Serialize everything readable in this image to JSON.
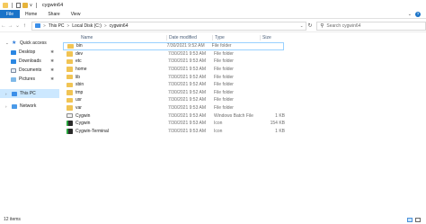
{
  "window": {
    "title": "cygwin64",
    "qa_more": "∨"
  },
  "ribbon": {
    "tabs": [
      "File",
      "Home",
      "Share",
      "View"
    ]
  },
  "address": {
    "breadcrumbs": [
      "This PC",
      "Local Disk (C:)",
      "cygwin64"
    ],
    "search_placeholder": "Search cygwin64"
  },
  "sidebar": {
    "items": [
      {
        "label": "Quick access",
        "icon": "star-icon",
        "indent": false,
        "pinned": false
      },
      {
        "label": "Desktop",
        "icon": "desktop-icon",
        "indent": true,
        "pinned": true
      },
      {
        "label": "Downloads",
        "icon": "downloads-icon",
        "indent": true,
        "pinned": true
      },
      {
        "label": "Documents",
        "icon": "documents-icon",
        "indent": true,
        "pinned": true
      },
      {
        "label": "Pictures",
        "icon": "pictures-icon",
        "indent": true,
        "pinned": true
      },
      {
        "label": "This PC",
        "icon": "this-pc-icon",
        "indent": false,
        "pinned": false,
        "selected": true
      },
      {
        "label": "Network",
        "icon": "network-icon",
        "indent": false,
        "pinned": false
      }
    ]
  },
  "columns": {
    "name": "Name",
    "date": "Date modified",
    "type": "Type",
    "size": "Size"
  },
  "files": [
    {
      "name": "bin",
      "date": "7/30/2021 9:52 AM",
      "type": "File folder",
      "size": "",
      "icon": "folder-icon"
    },
    {
      "name": "dev",
      "date": "7/30/2021 9:53 AM",
      "type": "File folder",
      "size": "",
      "icon": "folder-icon"
    },
    {
      "name": "etc",
      "date": "7/30/2021 9:53 AM",
      "type": "File folder",
      "size": "",
      "icon": "folder-icon"
    },
    {
      "name": "home",
      "date": "7/30/2021 9:53 AM",
      "type": "File folder",
      "size": "",
      "icon": "folder-icon"
    },
    {
      "name": "lib",
      "date": "7/30/2021 9:52 AM",
      "type": "File folder",
      "size": "",
      "icon": "folder-icon"
    },
    {
      "name": "sbin",
      "date": "7/30/2021 9:52 AM",
      "type": "File folder",
      "size": "",
      "icon": "folder-icon"
    },
    {
      "name": "tmp",
      "date": "7/30/2021 9:52 AM",
      "type": "File folder",
      "size": "",
      "icon": "folder-icon"
    },
    {
      "name": "usr",
      "date": "7/30/2021 9:52 AM",
      "type": "File folder",
      "size": "",
      "icon": "folder-icon"
    },
    {
      "name": "var",
      "date": "7/30/2021 9:53 AM",
      "type": "File folder",
      "size": "",
      "icon": "folder-icon"
    },
    {
      "name": "Cygwin",
      "date": "7/30/2021 9:53 AM",
      "type": "Windows Batch File",
      "size": "1 KB",
      "icon": "batch-file-icon"
    },
    {
      "name": "Cygwin",
      "date": "7/30/2021 9:53 AM",
      "type": "Icon",
      "size": "154 KB",
      "icon": "cygwin-icon"
    },
    {
      "name": "Cygwin-Terminal",
      "date": "7/30/2021 9:53 AM",
      "type": "Icon",
      "size": "1 KB",
      "icon": "cygwin-terminal-icon"
    }
  ],
  "status": {
    "count_text": "12 items"
  }
}
